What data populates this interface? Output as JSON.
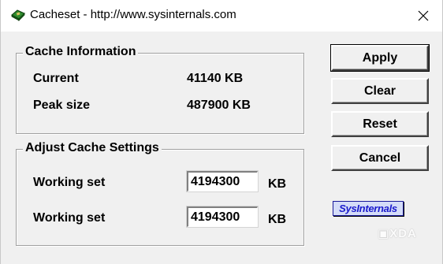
{
  "window": {
    "title": "Cacheset - http://www.sysinternals.com",
    "icon": "green-chip-icon",
    "close_glyph": "✕"
  },
  "cache_info": {
    "legend": "Cache Information",
    "current_label": "Current",
    "current_value": "41140 KB",
    "peak_label": "Peak size",
    "peak_value": "487900 KB"
  },
  "adjust": {
    "legend": "Adjust Cache Settings",
    "rows": [
      {
        "label": "Working set",
        "value": "4194300",
        "unit": "KB"
      },
      {
        "label": "Working set",
        "value": "4194300",
        "unit": "KB"
      }
    ]
  },
  "buttons": {
    "apply": "Apply",
    "clear": "Clear",
    "reset": "Reset",
    "cancel": "Cancel"
  },
  "logo": {
    "text": "SysInternals"
  },
  "watermark": {
    "text": "XDA"
  },
  "colors": {
    "dialog_bg": "#f0f0f0",
    "logo_text": "#1a1acc",
    "logo_bg": "#d4dcf8",
    "icon_green": "#2e8b2e"
  }
}
